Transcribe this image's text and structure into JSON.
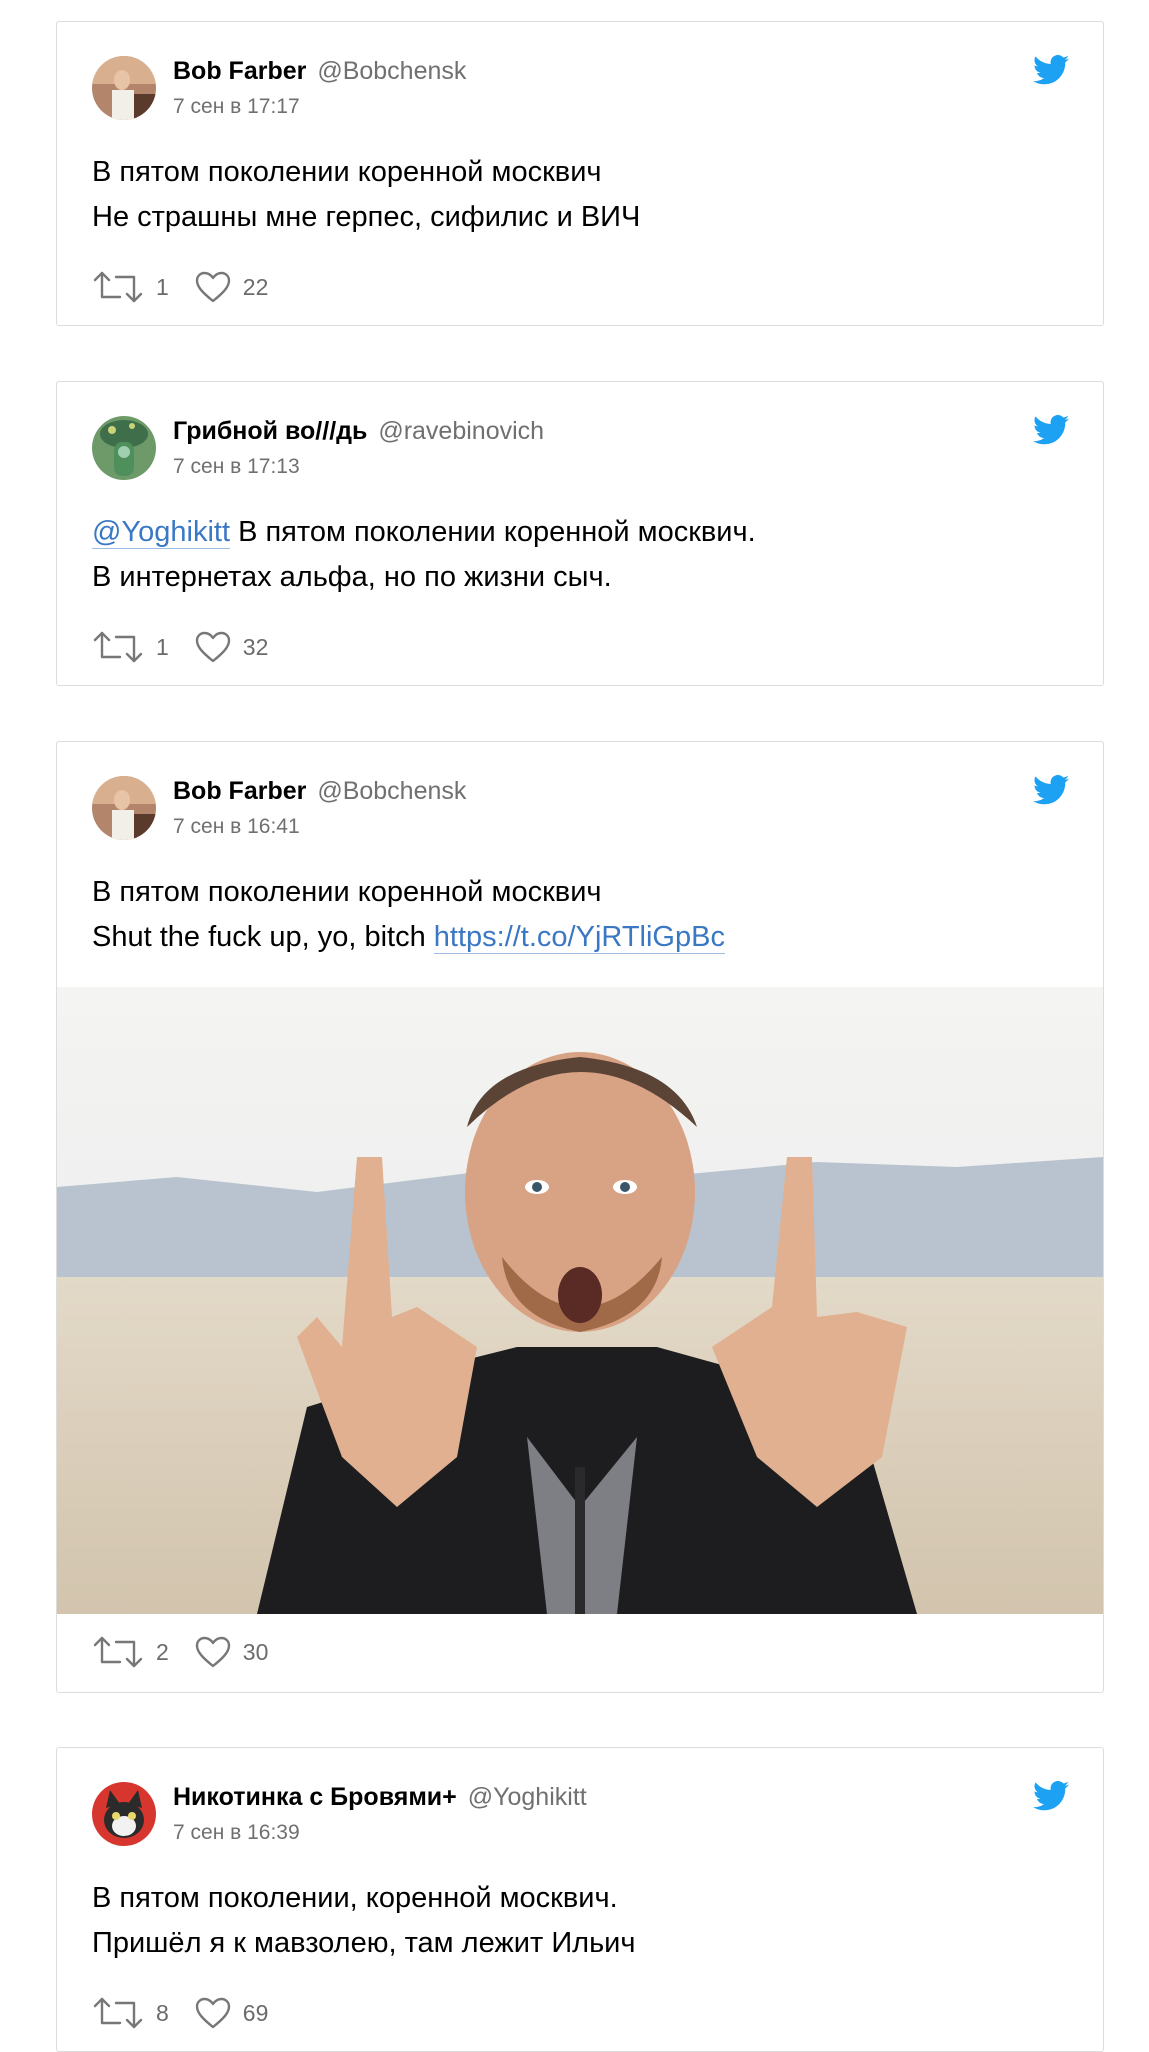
{
  "tweets": [
    {
      "name": "Bob Farber",
      "handle": "@Bobchensk",
      "date": "7 сен в 17:17",
      "lines": [
        "В пятом поколении коренной москвич",
        "Не страшны мне герпес, сифилис и ВИЧ"
      ],
      "retweets": "1",
      "likes": "22",
      "avatar": "bob-avatar"
    },
    {
      "name": "Грибной во///дь",
      "handle": "@ravebinovich",
      "date": "7 сен в 17:13",
      "mention": "@Yoghikitt",
      "line1_rest": " В пятом поколении коренной москвич.",
      "line2": "В интернетах альфа, но по жизни сыч.",
      "retweets": "1",
      "likes": "32",
      "avatar": "mushroom-avatar"
    },
    {
      "name": "Bob Farber",
      "handle": "@Bobchensk",
      "date": "7 сен в 16:41",
      "line1": "В пятом поколении коренной москвич",
      "line2_text": "Shut the fuck up, yo, bitch ",
      "link": "https://t.co/YjRTliGpBc",
      "retweets": "2",
      "likes": "30",
      "avatar": "bob-avatar",
      "photo": "man-middle-fingers-desert-photo"
    },
    {
      "name": "Никотинка с Бровями+",
      "handle": "@Yoghikitt",
      "date": "7 сен в 16:39",
      "lines": [
        "В пятом поколении, коренной москвич.",
        "Пришёл я к мавзолею, там лежит Ильич"
      ],
      "retweets": "8",
      "likes": "69",
      "avatar": "cat-avatar"
    }
  ],
  "colors": {
    "twitter_blue": "#1da1f2",
    "link": "#3b78c4",
    "meta": "#707070"
  }
}
